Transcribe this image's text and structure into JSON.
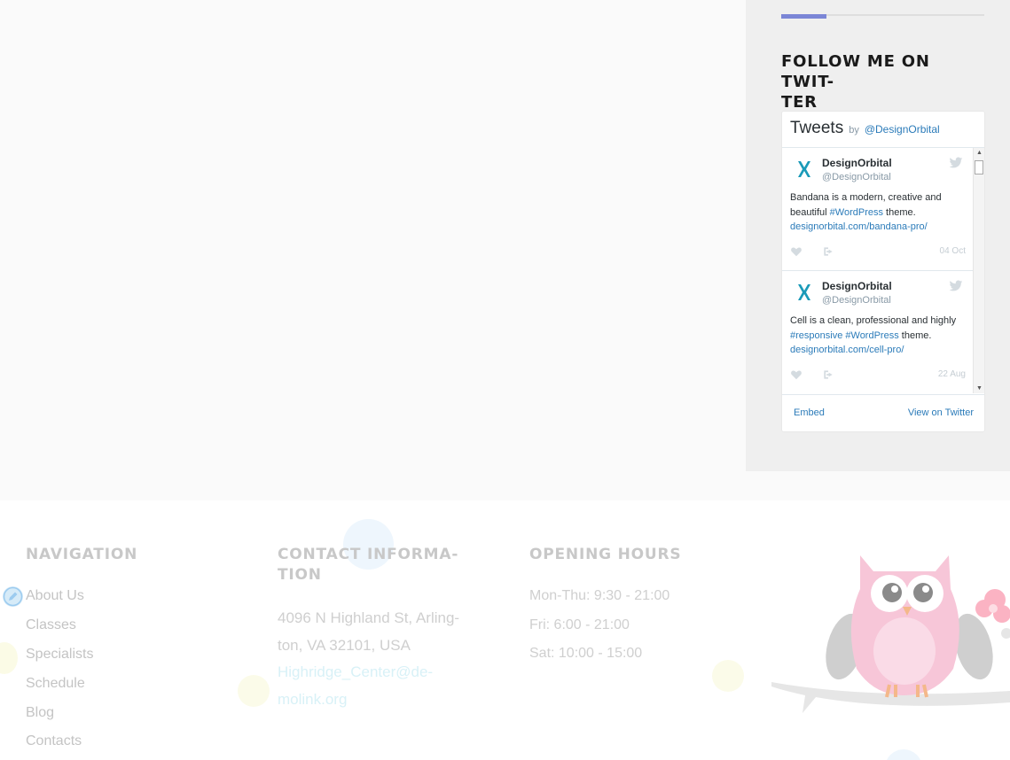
{
  "sidebar": {
    "title": "FOLLOW ME ON TWIT-TER",
    "title_line1": "FOLLOW ME ON TWIT-",
    "title_line2": "TER"
  },
  "twitter_widget": {
    "header_title": "Tweets",
    "header_by": "by",
    "header_user": "@DesignOrbital",
    "tweets": [
      {
        "name": "DesignOrbital",
        "handle": "@DesignOrbital",
        "text_1": "Bandana is a modern, creative and beautiful ",
        "hashtag_1": "#WordPress",
        "text_2": " theme.",
        "link": "designorbital.com/bandana-pro/",
        "date": "04 Oct"
      },
      {
        "name": "DesignOrbital",
        "handle": "@DesignOrbital",
        "text_1": "Cell is a clean, professional and highly ",
        "hashtag_1": "#responsive",
        "hashtag_2": "#WordPress",
        "text_2": " theme.",
        "link": "designorbital.com/cell-pro/",
        "date": "22 Aug"
      }
    ],
    "embed_label": "Embed",
    "view_label": "View on Twitter"
  },
  "footer": {
    "navigation": {
      "title": "NAVIGATION",
      "items": [
        "About Us",
        "Classes",
        "Specialists",
        "Schedule",
        "Blog",
        "Contacts"
      ]
    },
    "contact": {
      "title_line1": "CONTACT INFORMA-",
      "title_line2": "TION",
      "address_line1": "4096 N Highland St, Arling-",
      "address_line2": "ton, VA 32101, USA",
      "email_line1": "Highridge_Center@de-",
      "email_line2": "molink.org"
    },
    "hours": {
      "title": "OPENING HOURS",
      "items": [
        "Mon-Thu: 9:30 - 21:00",
        "Fri: 6:00 - 21:00",
        "Sat: 10:00 - 15:00"
      ]
    }
  },
  "colors": {
    "accent": "#7b86d6",
    "link": "#2b7bb9",
    "owl_pink": "#f7c6d8"
  }
}
